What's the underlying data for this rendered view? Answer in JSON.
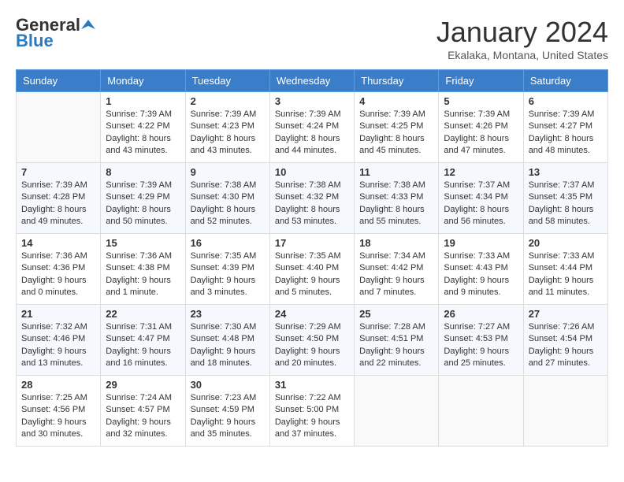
{
  "logo": {
    "general": "General",
    "blue": "Blue"
  },
  "header": {
    "month": "January 2024",
    "location": "Ekalaka, Montana, United States"
  },
  "days_of_week": [
    "Sunday",
    "Monday",
    "Tuesday",
    "Wednesday",
    "Thursday",
    "Friday",
    "Saturday"
  ],
  "weeks": [
    [
      {
        "day": "",
        "info": ""
      },
      {
        "day": "1",
        "info": "Sunrise: 7:39 AM\nSunset: 4:22 PM\nDaylight: 8 hours\nand 43 minutes."
      },
      {
        "day": "2",
        "info": "Sunrise: 7:39 AM\nSunset: 4:23 PM\nDaylight: 8 hours\nand 43 minutes."
      },
      {
        "day": "3",
        "info": "Sunrise: 7:39 AM\nSunset: 4:24 PM\nDaylight: 8 hours\nand 44 minutes."
      },
      {
        "day": "4",
        "info": "Sunrise: 7:39 AM\nSunset: 4:25 PM\nDaylight: 8 hours\nand 45 minutes."
      },
      {
        "day": "5",
        "info": "Sunrise: 7:39 AM\nSunset: 4:26 PM\nDaylight: 8 hours\nand 47 minutes."
      },
      {
        "day": "6",
        "info": "Sunrise: 7:39 AM\nSunset: 4:27 PM\nDaylight: 8 hours\nand 48 minutes."
      }
    ],
    [
      {
        "day": "7",
        "info": "Sunrise: 7:39 AM\nSunset: 4:28 PM\nDaylight: 8 hours\nand 49 minutes."
      },
      {
        "day": "8",
        "info": "Sunrise: 7:39 AM\nSunset: 4:29 PM\nDaylight: 8 hours\nand 50 minutes."
      },
      {
        "day": "9",
        "info": "Sunrise: 7:38 AM\nSunset: 4:30 PM\nDaylight: 8 hours\nand 52 minutes."
      },
      {
        "day": "10",
        "info": "Sunrise: 7:38 AM\nSunset: 4:32 PM\nDaylight: 8 hours\nand 53 minutes."
      },
      {
        "day": "11",
        "info": "Sunrise: 7:38 AM\nSunset: 4:33 PM\nDaylight: 8 hours\nand 55 minutes."
      },
      {
        "day": "12",
        "info": "Sunrise: 7:37 AM\nSunset: 4:34 PM\nDaylight: 8 hours\nand 56 minutes."
      },
      {
        "day": "13",
        "info": "Sunrise: 7:37 AM\nSunset: 4:35 PM\nDaylight: 8 hours\nand 58 minutes."
      }
    ],
    [
      {
        "day": "14",
        "info": "Sunrise: 7:36 AM\nSunset: 4:36 PM\nDaylight: 9 hours\nand 0 minutes."
      },
      {
        "day": "15",
        "info": "Sunrise: 7:36 AM\nSunset: 4:38 PM\nDaylight: 9 hours\nand 1 minute."
      },
      {
        "day": "16",
        "info": "Sunrise: 7:35 AM\nSunset: 4:39 PM\nDaylight: 9 hours\nand 3 minutes."
      },
      {
        "day": "17",
        "info": "Sunrise: 7:35 AM\nSunset: 4:40 PM\nDaylight: 9 hours\nand 5 minutes."
      },
      {
        "day": "18",
        "info": "Sunrise: 7:34 AM\nSunset: 4:42 PM\nDaylight: 9 hours\nand 7 minutes."
      },
      {
        "day": "19",
        "info": "Sunrise: 7:33 AM\nSunset: 4:43 PM\nDaylight: 9 hours\nand 9 minutes."
      },
      {
        "day": "20",
        "info": "Sunrise: 7:33 AM\nSunset: 4:44 PM\nDaylight: 9 hours\nand 11 minutes."
      }
    ],
    [
      {
        "day": "21",
        "info": "Sunrise: 7:32 AM\nSunset: 4:46 PM\nDaylight: 9 hours\nand 13 minutes."
      },
      {
        "day": "22",
        "info": "Sunrise: 7:31 AM\nSunset: 4:47 PM\nDaylight: 9 hours\nand 16 minutes."
      },
      {
        "day": "23",
        "info": "Sunrise: 7:30 AM\nSunset: 4:48 PM\nDaylight: 9 hours\nand 18 minutes."
      },
      {
        "day": "24",
        "info": "Sunrise: 7:29 AM\nSunset: 4:50 PM\nDaylight: 9 hours\nand 20 minutes."
      },
      {
        "day": "25",
        "info": "Sunrise: 7:28 AM\nSunset: 4:51 PM\nDaylight: 9 hours\nand 22 minutes."
      },
      {
        "day": "26",
        "info": "Sunrise: 7:27 AM\nSunset: 4:53 PM\nDaylight: 9 hours\nand 25 minutes."
      },
      {
        "day": "27",
        "info": "Sunrise: 7:26 AM\nSunset: 4:54 PM\nDaylight: 9 hours\nand 27 minutes."
      }
    ],
    [
      {
        "day": "28",
        "info": "Sunrise: 7:25 AM\nSunset: 4:56 PM\nDaylight: 9 hours\nand 30 minutes."
      },
      {
        "day": "29",
        "info": "Sunrise: 7:24 AM\nSunset: 4:57 PM\nDaylight: 9 hours\nand 32 minutes."
      },
      {
        "day": "30",
        "info": "Sunrise: 7:23 AM\nSunset: 4:59 PM\nDaylight: 9 hours\nand 35 minutes."
      },
      {
        "day": "31",
        "info": "Sunrise: 7:22 AM\nSunset: 5:00 PM\nDaylight: 9 hours\nand 37 minutes."
      },
      {
        "day": "",
        "info": ""
      },
      {
        "day": "",
        "info": ""
      },
      {
        "day": "",
        "info": ""
      }
    ]
  ]
}
